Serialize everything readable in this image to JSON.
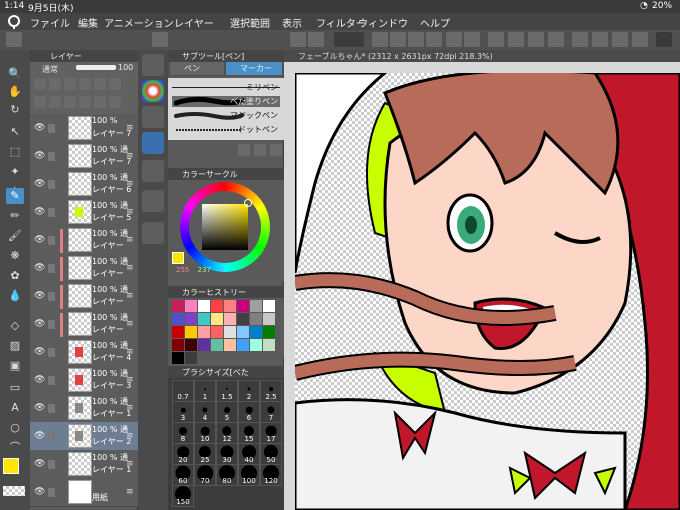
{
  "status": {
    "time": "1:14",
    "date": "9月5日(木)",
    "battery": "20%"
  },
  "menu": {
    "items": [
      "ファイル",
      "編集",
      "アニメーション",
      "レイヤー",
      "選択範囲",
      "表示",
      "フィルター",
      "ウィンドウ",
      "ヘルプ"
    ]
  },
  "layer_panel": {
    "tab_label": "レイヤー",
    "blend_mode": "通常",
    "opacity": "100",
    "layers": [
      {
        "pct": "100 %",
        "name": "レイヤー 7",
        "thumb": "checker"
      },
      {
        "pct": "100 % 通",
        "name": "レイヤー 7",
        "thumb": "checker"
      },
      {
        "pct": "100 % 通",
        "name": "レイヤー 6",
        "thumb": "checker"
      },
      {
        "pct": "100 % 通",
        "name": "レイヤー 5",
        "thumb": "green"
      },
      {
        "pct": "100 % 通",
        "name": "レイヤー",
        "thumb": "checker"
      },
      {
        "pct": "100 % 通",
        "name": "レイヤー",
        "thumb": "checker"
      },
      {
        "pct": "100 % 通",
        "name": "レイヤー",
        "thumb": "checker"
      },
      {
        "pct": "100 % 通",
        "name": "レイヤー",
        "thumb": "checker"
      },
      {
        "pct": "100 % 通",
        "name": "レイヤー 4",
        "thumb": "red"
      },
      {
        "pct": "100 % 通",
        "name": "レイヤー 3",
        "thumb": "red"
      },
      {
        "pct": "100 % 通",
        "name": "レイヤー 1",
        "thumb": "sketch"
      },
      {
        "pct": "100 % 通",
        "name": "レイヤー 2",
        "thumb": "sketch",
        "selected": true
      },
      {
        "pct": "100 % 通",
        "name": "レイヤー 1",
        "thumb": "checker"
      },
      {
        "pct": "",
        "name": "用紙",
        "thumb": "white"
      }
    ]
  },
  "subtool": {
    "header": "サブツール[ペン]",
    "tabs": [
      "ペン",
      "マーカー"
    ],
    "brushes": [
      "ミリペン",
      "べた塗りペン",
      "マジックペン",
      "ドットペン"
    ]
  },
  "color_circle": {
    "header": "カラーサークル",
    "r": "255",
    "g": "237",
    "b": "0"
  },
  "color_history": {
    "header": "カラーヒストリー"
  },
  "brush_size": {
    "header": "ブラシサイズ[べた",
    "sizes": [
      "0.7",
      "1",
      "1.5",
      "2",
      "2.5",
      "3",
      "4",
      "5",
      "6",
      "7",
      "8",
      "10",
      "12",
      "15",
      "17",
      "20",
      "25",
      "30",
      "40",
      "50",
      "60",
      "70",
      "80",
      "100",
      "120",
      "150"
    ]
  },
  "canvas": {
    "tab_title": "フェーブルちゃん* (2312 x 2631px 72dpi 218.3%)"
  },
  "colors": {
    "main": "#ffe600",
    "accent": "#4a90c8"
  },
  "history_swatches": [
    "#c81e5a",
    "#ff80c0",
    "#ffffff",
    "#ff4040",
    "#ff8080",
    "#c80080",
    "#a0a0a0",
    "#ffffff",
    "#5050c8",
    "#8040c8",
    "#40c8c8",
    "#ffe680",
    "#ffb0b0",
    "#404040",
    "#808080",
    "#c8c8c8",
    "#c80000",
    "#ffc800",
    "#ffa0a0",
    "#ff6060",
    "#e0e0e0",
    "#80c8ff",
    "#0080c8",
    "#008000",
    "#800000",
    "#400000",
    "#6030a0",
    "#60c0a0",
    "#ffc0a0",
    "#40a0ff",
    "#a0ffe0",
    "#c0e0c0",
    "#000000",
    "#3c3c3c"
  ]
}
